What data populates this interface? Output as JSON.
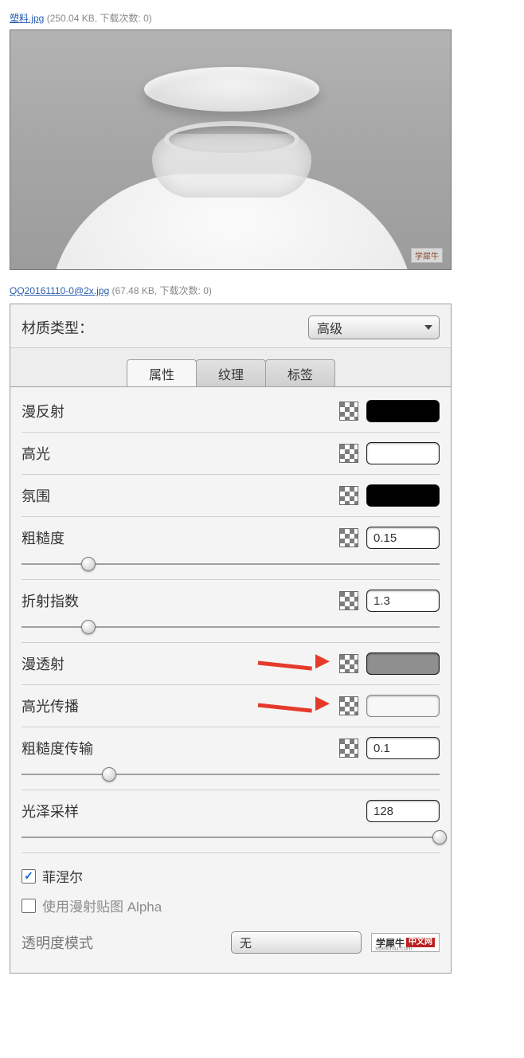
{
  "attachment1": {
    "name": "塑料.jpg",
    "meta": "(250.04 KB, 下载次数: 0)"
  },
  "render": {
    "watermark": "学犀牛"
  },
  "attachment2": {
    "name": "QQ20161110-0@2x.jpg",
    "meta": "(67.48 KB, 下载次数: 0)"
  },
  "header": {
    "material_type_label": "材质类型：",
    "material_type_value": "高级"
  },
  "tabs": {
    "t1": "属性",
    "t2": "纹理",
    "t3": "标签"
  },
  "params": {
    "diffuse": {
      "label": "漫反射"
    },
    "specular": {
      "label": "高光"
    },
    "ambient": {
      "label": "氛围"
    },
    "roughness": {
      "label": "粗糙度",
      "value": "0.15",
      "pos": 16
    },
    "ior": {
      "label": "折射指数",
      "value": "1.3",
      "pos": 16
    },
    "transmission": {
      "label": "漫透射"
    },
    "spec_trans": {
      "label": "高光传播"
    },
    "trans_roughness": {
      "label": "粗糙度传输",
      "value": "0.1",
      "pos": 21
    },
    "gloss_samples": {
      "label": "光泽采样",
      "value": "128",
      "pos": 100
    }
  },
  "checks": {
    "fresnel": {
      "label": "菲涅尔",
      "checked": true
    },
    "use_diffuse_alpha": {
      "label": "使用漫射贴图 Alpha",
      "checked": false
    }
  },
  "mode": {
    "label": "透明度模式",
    "value": "无"
  },
  "logo": {
    "main": "学犀牛",
    "badge": "中文网",
    "sub": "xuexiniu.com"
  }
}
